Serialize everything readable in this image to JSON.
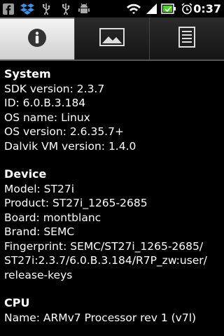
{
  "status_bar": {
    "time": "0:37",
    "left_icons": [
      "facebook-icon",
      "dropbox-icon",
      "usb-icon",
      "usb-icon",
      "android-debug-icon"
    ],
    "right_icons": [
      "wifi-icon",
      "signal-icon",
      "battery-icon",
      "alarm-icon"
    ]
  },
  "tabs": [
    {
      "name": "info",
      "icon": "info-icon",
      "active": true
    },
    {
      "name": "display",
      "icon": "image-icon",
      "active": false
    },
    {
      "name": "list",
      "icon": "list-icon",
      "active": false
    }
  ],
  "system": {
    "title": "System",
    "sdk": "SDK version: 2.3.7",
    "id": "ID: 6.0.B.3.184",
    "os_name": "OS name: Linux",
    "os_version": "OS version: 2.6.35.7+",
    "dalvik": "Dalvik VM version: 1.4.0"
  },
  "device": {
    "title": "Device",
    "model": "Model: ST27i",
    "product": "Product: ST27i_1265-2685",
    "board": "Board: montblanc",
    "brand": "Brand: SEMC",
    "fingerprint_1": "Fingerprint: SEMC/ST27i_1265-2685/",
    "fingerprint_2": "ST27i:2.3.7/6.0.B.3.184/R7P_zw:user/",
    "fingerprint_3": "release-keys"
  },
  "cpu": {
    "title": "CPU",
    "name": "Name: ARMv7 Processor rev 1 (v7l)"
  },
  "colors": {
    "background": "#000000",
    "text": "#ffffff",
    "battery_green": "#4cd12b"
  }
}
